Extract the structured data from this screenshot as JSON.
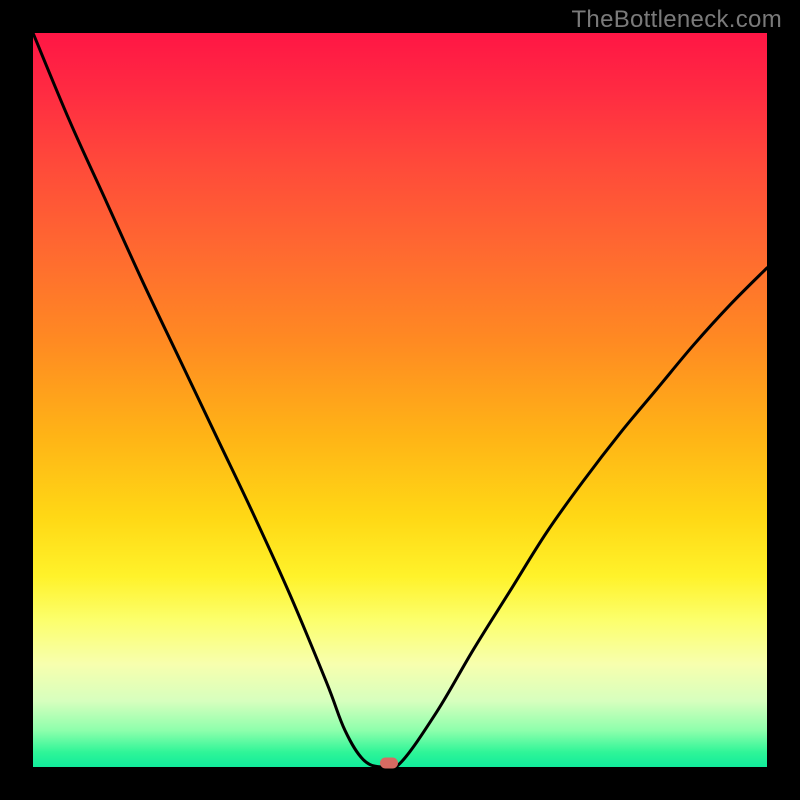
{
  "watermark": "TheBottleneck.com",
  "chart_data": {
    "type": "line",
    "title": "",
    "xlabel": "",
    "ylabel": "",
    "xlim": [
      0,
      1
    ],
    "ylim": [
      0,
      1
    ],
    "x": [
      0.0,
      0.05,
      0.1,
      0.15,
      0.2,
      0.25,
      0.3,
      0.35,
      0.4,
      0.425,
      0.45,
      0.475,
      0.5,
      0.55,
      0.6,
      0.65,
      0.7,
      0.75,
      0.8,
      0.85,
      0.9,
      0.95,
      1.0
    ],
    "values": [
      1.0,
      0.88,
      0.77,
      0.66,
      0.555,
      0.45,
      0.345,
      0.235,
      0.115,
      0.05,
      0.01,
      0.0,
      0.005,
      0.075,
      0.16,
      0.24,
      0.32,
      0.39,
      0.455,
      0.515,
      0.575,
      0.63,
      0.68
    ],
    "flat_segment": {
      "x0": 0.44,
      "x1": 0.485,
      "y": 0.0
    },
    "marker": {
      "x": 0.485,
      "y": 0.005,
      "color": "#d86a62"
    },
    "background_gradient": {
      "top": "#ff1645",
      "mid": "#fff22a",
      "bottom": "#11ec9b"
    }
  }
}
